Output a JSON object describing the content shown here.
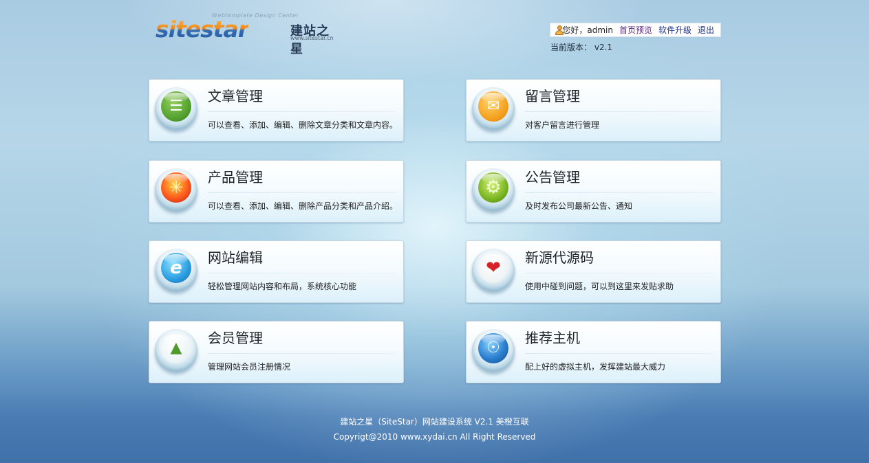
{
  "logo": {
    "tagline": "Webtemplate Design Center",
    "word": "sitestar",
    "cn": "建站之星",
    "url": "www.sitestar.cn"
  },
  "user_bar": {
    "greeting": "您好，admin",
    "links": [
      "首页预览",
      "软件升级",
      "退出"
    ],
    "version_label": "当前版本：",
    "version": "v2.1"
  },
  "cards": [
    {
      "title": "文章管理",
      "desc": "可以查看、添加、编辑、删除文章分类和文章内容。",
      "icon": "document-icon"
    },
    {
      "title": "留言管理",
      "desc": "对客户留言进行管理",
      "icon": "mail-icon"
    },
    {
      "title": "产品管理",
      "desc": "可以查看、添加、编辑、删除产品分类和产品介绍。",
      "icon": "product-icon"
    },
    {
      "title": "公告管理",
      "desc": "及时发布公司最新公告、通知",
      "icon": "gear-icon"
    },
    {
      "title": "网站编辑",
      "desc": "轻松管理网站内容和布局，系统核心功能",
      "icon": "ie-icon"
    },
    {
      "title": "新源代源码",
      "desc": "使用中碰到问题，可以到这里来发贴求助",
      "icon": "heart-icon"
    },
    {
      "title": "会员管理",
      "desc": "管理网站会员注册情况",
      "icon": "member-icon"
    },
    {
      "title": "推荐主机",
      "desc": "配上好的虚拟主机，发挥建站最大威力",
      "icon": "globe-icon"
    }
  ],
  "footer": {
    "line1": "建站之星（SiteStar）网站建设系统 V2.1 美橙互联",
    "line2": "Copyrigt@2010 www.xydai.cn All Right Reserved"
  }
}
